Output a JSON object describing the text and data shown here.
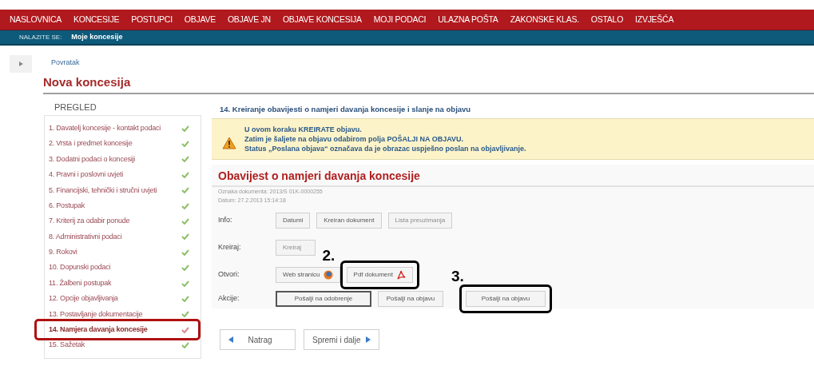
{
  "nav": {
    "items": [
      {
        "label": "NASLOVNICA"
      },
      {
        "label": "KONCESIJE"
      },
      {
        "label": "POSTUPCI"
      },
      {
        "label": "OBJAVE"
      },
      {
        "label": "OBJAVE JN"
      },
      {
        "label": "OBJAVE KONCESIJA"
      },
      {
        "label": "MOJI PODACI"
      },
      {
        "label": "ULAZNA POŠTA"
      },
      {
        "label": "ZAKONSKE KLAS."
      },
      {
        "label": "OSTALO"
      },
      {
        "label": "IZVJEŠĆA"
      }
    ]
  },
  "breadcrumb": {
    "label": "NALAZITE SE:",
    "current": "Moje koncesije"
  },
  "back_link": "Povratak",
  "page_title": "Nova koncesija",
  "sidebar": {
    "heading": "PREGLED",
    "steps": [
      {
        "label": "1. Davatelj koncesije - kontakt podaci",
        "selected": false
      },
      {
        "label": "2. Vrsta i predmet koncesije",
        "selected": false
      },
      {
        "label": "3. Dodatni podaci o koncesiji",
        "selected": false
      },
      {
        "label": "4. Pravni i poslovni uvjeti",
        "selected": false
      },
      {
        "label": "5. Financijski, tehnički i stručni uvjeti",
        "selected": false
      },
      {
        "label": "6. Postupak",
        "selected": false
      },
      {
        "label": "7. Kriterij za odabir ponude",
        "selected": false
      },
      {
        "label": "8. Administrativni podaci",
        "selected": false
      },
      {
        "label": "9. Rokovi",
        "selected": false
      },
      {
        "label": "10. Dopunski podaci",
        "selected": false
      },
      {
        "label": "11. Žalbeni postupak",
        "selected": false
      },
      {
        "label": "12. Opcije objavljivanja",
        "selected": false
      },
      {
        "label": "13. Postavljanje dokumentacije",
        "selected": false
      },
      {
        "label": "14. Namjera davanja koncesije",
        "selected": true
      },
      {
        "label": "15. Sažetak",
        "selected": false
      }
    ]
  },
  "main": {
    "section_title": "14. Kreiranje obavijesti o namjeri davanja koncesije i slanje na objavu",
    "alert": [
      "U ovom koraku KREIRATE objavu.",
      "Zatim je šaljete na objavu odabirom polja POŠALJI NA OBJAVU.",
      "Status „Poslana objava“ označava da je obrazac uspješno poslan na objavljivanje."
    ],
    "form": {
      "title": "Obavijest o namjeri davanja koncesije",
      "meta": [
        "Oznaka dokumenta: 2013/S 01K-0000255",
        "Datum: 27.2.2013 15:14:18"
      ],
      "rows": [
        {
          "label": "Info:",
          "buttons": [
            {
              "label": "Datumi",
              "disabled": false,
              "focused": false
            },
            {
              "label": "Kreiran dokument",
              "disabled": false,
              "focused": false
            },
            {
              "label": "Lista preuzimanja",
              "disabled": true,
              "focused": false
            }
          ]
        },
        {
          "label": "Kreiraj:",
          "buttons": [
            {
              "label": "Kreiraj",
              "disabled": true,
              "focused": false
            }
          ]
        },
        {
          "label": "Otvori:",
          "buttons": [
            {
              "label": "Web stranicu",
              "disabled": false,
              "focused": false
            },
            {
              "label": "Pdf dokument",
              "disabled": false,
              "focused": false
            }
          ]
        },
        {
          "label": "Akcije:",
          "buttons": [
            {
              "label": "Pošalji na odobrenje",
              "disabled": false,
              "focused": true
            },
            {
              "label": "Pošalji na objavu",
              "disabled": false,
              "focused": false
            },
            {
              "label": "Pošalji na objavu",
              "disabled": false,
              "focused": false
            }
          ]
        }
      ]
    },
    "nav_buttons": [
      {
        "label": "Natrag",
        "kind": "back"
      },
      {
        "label": "Spremi i dalje",
        "kind": "next"
      }
    ]
  },
  "annotations": [
    {
      "label": "2."
    },
    {
      "label": "3."
    }
  ]
}
